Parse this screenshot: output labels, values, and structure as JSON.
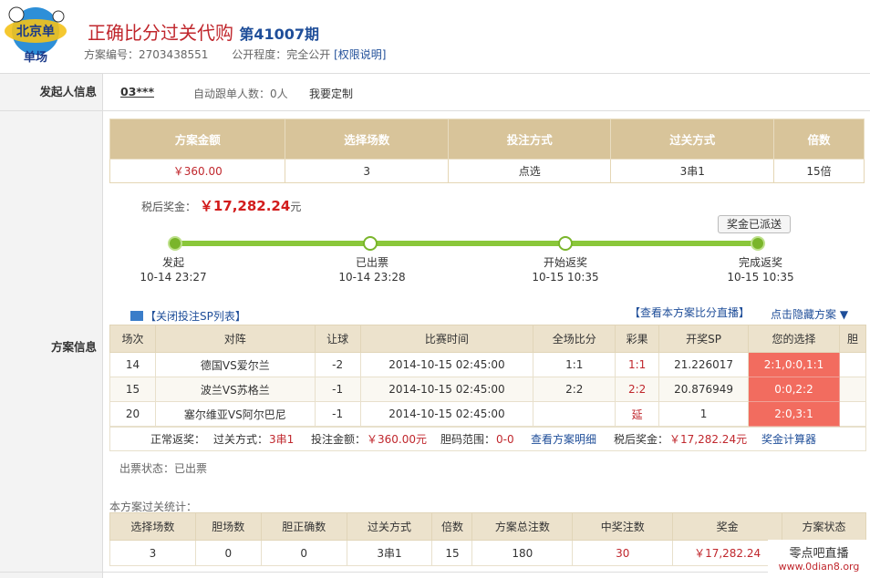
{
  "header": {
    "logo_text": "单场",
    "title": "正确比分过关代购",
    "issue": "第41007期",
    "plan_no_label": "方案编号：",
    "plan_no": "2703438551",
    "public_label": "公开程度：",
    "public_value": "完全公开",
    "perm_link": "[权限说明]"
  },
  "initiator": {
    "label": "发起人信息",
    "user": "03***",
    "auto_follow": "自动跟单人数：0人",
    "custom": "我要定制"
  },
  "plan_label": "方案信息",
  "plan_summary": {
    "headers": [
      "方案金额",
      "选择场数",
      "投注方式",
      "过关方式",
      "倍数"
    ],
    "values": [
      "￥360.00",
      "3",
      "点选",
      "3串1",
      "15倍"
    ]
  },
  "aftertax": {
    "label": "税后奖金：",
    "amount": "￥17,282.24",
    "unit": "元"
  },
  "sent_button": "奖金已派送",
  "progress": [
    {
      "label": "发起",
      "time": "10-14 23:27"
    },
    {
      "label": "已出票",
      "time": "10-14 23:28"
    },
    {
      "label": "开始返奖",
      "time": "10-15 10:35"
    },
    {
      "label": "完成返奖",
      "time": "10-15 10:35"
    }
  ],
  "toolbar": {
    "close_sp": "【关闭投注SP列表】",
    "live": "【查看本方案比分直播】",
    "hide": "点击隐藏方案 ▼"
  },
  "matches": {
    "headers": [
      "场次",
      "对阵",
      "让球",
      "比赛时间",
      "全场比分",
      "彩果",
      "开奖SP",
      "您的选择",
      "胆"
    ],
    "rows": [
      {
        "no": "14",
        "match": "德国VS爱尔兰",
        "handicap": "-2",
        "time": "2014-10-15 02:45:00",
        "score": "1:1",
        "result": "1:1",
        "sp": "21.226017",
        "choice": "2:1,0:0,1:1",
        "dan": ""
      },
      {
        "no": "15",
        "match": "波兰VS苏格兰",
        "handicap": "-1",
        "time": "2014-10-15 02:45:00",
        "score": "2:2",
        "result": "2:2",
        "sp": "20.876949",
        "choice": "0:0,2:2",
        "dan": ""
      },
      {
        "no": "20",
        "match": "塞尔维亚VS阿尔巴尼",
        "handicap": "-1",
        "time": "2014-10-15 02:45:00",
        "score": "",
        "result": "延",
        "sp": "1",
        "choice": "2:0,3:1",
        "dan": ""
      }
    ]
  },
  "summary_line": {
    "normal": "正常返奖：",
    "pass_label": "过关方式：",
    "pass_value": "3串1",
    "amount_label": "投注金额：",
    "amount_value": "￥360.00元",
    "dan_label": "胆码范围：",
    "dan_value": "0-0",
    "detail": "查看方案明细",
    "aftertax_label": "税后奖金：",
    "aftertax_value": "￥17,282.24元",
    "calc": "奖金计算器"
  },
  "chupiao": "出票状态：已出票",
  "stats": {
    "title": "本方案过关统计：",
    "headers": [
      "选择场数",
      "胆场数",
      "胆正确数",
      "过关方式",
      "倍数",
      "方案总注数",
      "中奖注数",
      "奖金",
      "方案状态"
    ],
    "values": [
      "3",
      "0",
      "0",
      "3串1",
      "15",
      "180",
      "30",
      "￥17,282.24",
      ""
    ]
  },
  "watermark": {
    "line1": "零点吧直播",
    "line2": "www.0dian8.org"
  }
}
